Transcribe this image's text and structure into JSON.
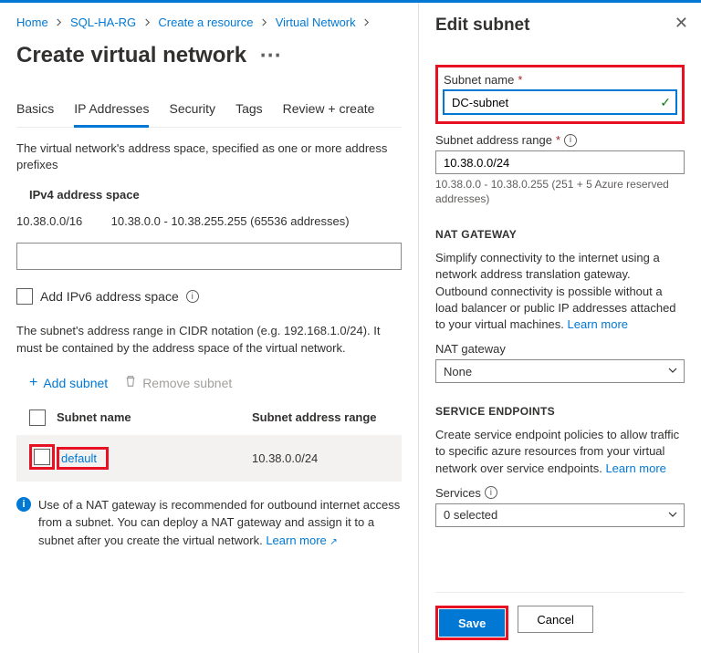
{
  "breadcrumb": [
    "Home",
    "SQL-HA-RG",
    "Create a resource",
    "Virtual Network"
  ],
  "left": {
    "title": "Create virtual network",
    "tabs": [
      "Basics",
      "IP Addresses",
      "Security",
      "Tags",
      "Review + create"
    ],
    "active_tab_index": 1,
    "desc": "The virtual network's address space, specified as one or more address prefixes",
    "ipv4_label": "IPv4 address space",
    "addr": {
      "ip": "10.38.0.0/16",
      "range": "10.38.0.0 - 10.38.255.255 (65536 addresses)"
    },
    "ipv6_checkbox": "Add IPv6 address space",
    "subnet_desc": "The subnet's address range in CIDR notation (e.g. 192.168.1.0/24). It must be contained by the address space of the virtual network.",
    "add_subnet": "Add subnet",
    "remove_subnet": "Remove subnet",
    "table_headers": {
      "name": "Subnet name",
      "range": "Subnet address range"
    },
    "table_row": {
      "name": "default",
      "range": "10.38.0.0/24"
    },
    "nat_info": "Use of a NAT gateway is recommended for outbound internet access from a subnet. You can deploy a NAT gateway and assign it to a subnet after you create the virtual network.",
    "learn_more": "Learn more"
  },
  "right": {
    "title": "Edit subnet",
    "subnet_name_label": "Subnet name",
    "subnet_name_value": "DC-subnet",
    "range_label": "Subnet address range",
    "range_value": "10.38.0.0/24",
    "range_hint": "10.38.0.0 - 10.38.0.255 (251 + 5 Azure reserved addresses)",
    "nat_head": "NAT GATEWAY",
    "nat_para": "Simplify connectivity to the internet using a network address translation gateway. Outbound connectivity is possible without a load balancer or public IP addresses attached to your virtual machines.",
    "learn_more": "Learn more",
    "nat_gateway_label": "NAT gateway",
    "nat_gateway_value": "None",
    "se_head": "SERVICE ENDPOINTS",
    "se_para": "Create service endpoint policies to allow traffic to specific azure resources from your virtual network over service endpoints.",
    "services_label": "Services",
    "services_value": "0 selected",
    "save": "Save",
    "cancel": "Cancel"
  }
}
